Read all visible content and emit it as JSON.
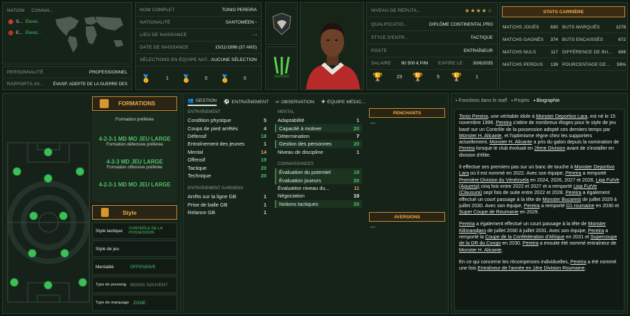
{
  "nation": {
    "header_nation": "NATION",
    "header_club": "CONNAI...",
    "rows": [
      {
        "flag": "S...",
        "level": "Étend..."
      },
      {
        "flag": "E...",
        "level": "Étend..."
      }
    ]
  },
  "personality": {
    "label": "PERSONNALITÉ",
    "value": "PROFESSIONNEL"
  },
  "media": {
    "label": "RAPPORTS AV...",
    "value": "ÉVASIF, ADEPTE DE LA GUERRE DES"
  },
  "info": [
    {
      "label": "NOM COMPLET",
      "value": "TONIO PEREIRA"
    },
    {
      "label": "NATIONALITÉ",
      "value": "SANTOMÉEN"
    },
    {
      "label": "LIEU DE NAISSANCE",
      "value": "-"
    },
    {
      "label": "DATE DE NAISSANCE",
      "value": "15/11/1996 (37 ANS)"
    },
    {
      "label": "SÉLECTIONS EN ÉQUIPE NAT...",
      "value": "AUCUNE SÉLECTION"
    }
  ],
  "medals": [
    "1",
    "0",
    "0"
  ],
  "profile": {
    "reputation_label": "NIVEAU DE RÉPUTA...",
    "reputation_stars": "★★★★☆",
    "qualif_label": "QUALIFICATIO...",
    "qualif_value": "DIPLÔME CONTINENTAL PRO",
    "style_label": "STYLE D'ENTR...",
    "style_value": "TACTIQUE",
    "post_label": "POSTE",
    "post_value": "ENTRAÎNEUR",
    "salary_label": "SALAIRE",
    "salary_value": "90 500 € P/M",
    "expire_label": "EXPIRE LE",
    "expire_value": "30/6/2035"
  },
  "trophies": [
    "23",
    "5",
    "1"
  ],
  "career": {
    "title": "STATS CARRIÈRE",
    "left": [
      {
        "label": "MATCHS JOUÉS",
        "value": "630"
      },
      {
        "label": "MATCHS GAGNÉS",
        "value": "374"
      },
      {
        "label": "MATCHS NULS",
        "value": "117"
      },
      {
        "label": "MATCHS PERDUS",
        "value": "139"
      }
    ],
    "right": [
      {
        "label": "BUTS MARQUÉS",
        "value": "1278"
      },
      {
        "label": "BUTS ENCAISSÉS",
        "value": "672"
      },
      {
        "label": "DIFFÉRENCE DE BU...",
        "value": "606"
      },
      {
        "label": "POURCENTAGE DE...",
        "value": "59%"
      }
    ]
  },
  "formations": {
    "title": "FORMATIONS",
    "preferred_label": "Formation préférée",
    "items": [
      {
        "name": "4-2-3-1 MD MO JEU LARGE",
        "desc": "Formation défensive préférée"
      },
      {
        "name": "4-3-3 MD JEU LARGE",
        "desc": "Formation offensive préférée"
      },
      {
        "name": "4-2-3-1 MD MO JEU LARGE",
        "desc": ""
      }
    ],
    "style_title": "Style",
    "style_rows": [
      {
        "label": "Style tactique",
        "value": "CONTRÔLE DE LA POSSESSION"
      },
      {
        "label": "Style de jeu",
        "value": ""
      },
      {
        "label": "Mentalité",
        "value": "OFFENSIVE"
      },
      {
        "label": "Type de pressing",
        "value": "MOINS SOUVENT"
      },
      {
        "label": "Type de marquage",
        "value": "ZONE"
      }
    ]
  },
  "tabs": [
    "GESTION",
    "ENTRAÎNEMENT",
    "OBSERVATION",
    "ÉQUIPE MÉDIC..."
  ],
  "attrs": {
    "training_title": "ENTRAÎNEMENT",
    "training": [
      {
        "name": "Condition physique",
        "value": "5"
      },
      {
        "name": "Coups de pied arrêtés",
        "value": "4"
      },
      {
        "name": "Défensif",
        "value": "18"
      },
      {
        "name": "Entraînement des jeunes",
        "value": "1"
      },
      {
        "name": "Mental",
        "value": "14"
      },
      {
        "name": "Offensif",
        "value": "19"
      },
      {
        "name": "Tactique",
        "value": "20"
      },
      {
        "name": "Technique",
        "value": "20"
      }
    ],
    "gk_title": "ENTRAÎNEMENT GARDIENS",
    "gk": [
      {
        "name": "Arrêts sur la ligne GB",
        "value": "1"
      },
      {
        "name": "Prise de balle GB",
        "value": "1"
      },
      {
        "name": "Relance GB",
        "value": "1"
      }
    ],
    "mental_title": "MENTAL",
    "mental": [
      {
        "name": "Adaptabilité",
        "value": "1"
      },
      {
        "name": "Capacité à motiver",
        "value": "20"
      },
      {
        "name": "Détermination",
        "value": "7"
      },
      {
        "name": "Gestion des personnes",
        "value": "20"
      },
      {
        "name": "Niveau de discipline",
        "value": "1"
      }
    ],
    "knowledge_title": "CONNAISSANCES",
    "knowledge": [
      {
        "name": "Évaluation du potentiel",
        "value": "19"
      },
      {
        "name": "Évaluation joueurs",
        "value": "20"
      },
      {
        "name": "Évaluation niveau du...",
        "value": "11"
      },
      {
        "name": "Négociation",
        "value": "10"
      },
      {
        "name": "Notions tactiques",
        "value": "20"
      }
    ],
    "penchants_title": "PENCHANTS",
    "penchants_value": "---",
    "aversions_title": "AVERSIONS",
    "aversions_value": "---"
  },
  "bio_tabs": [
    "Fonctions dans le staff",
    "Projets",
    "Biographie"
  ]
}
